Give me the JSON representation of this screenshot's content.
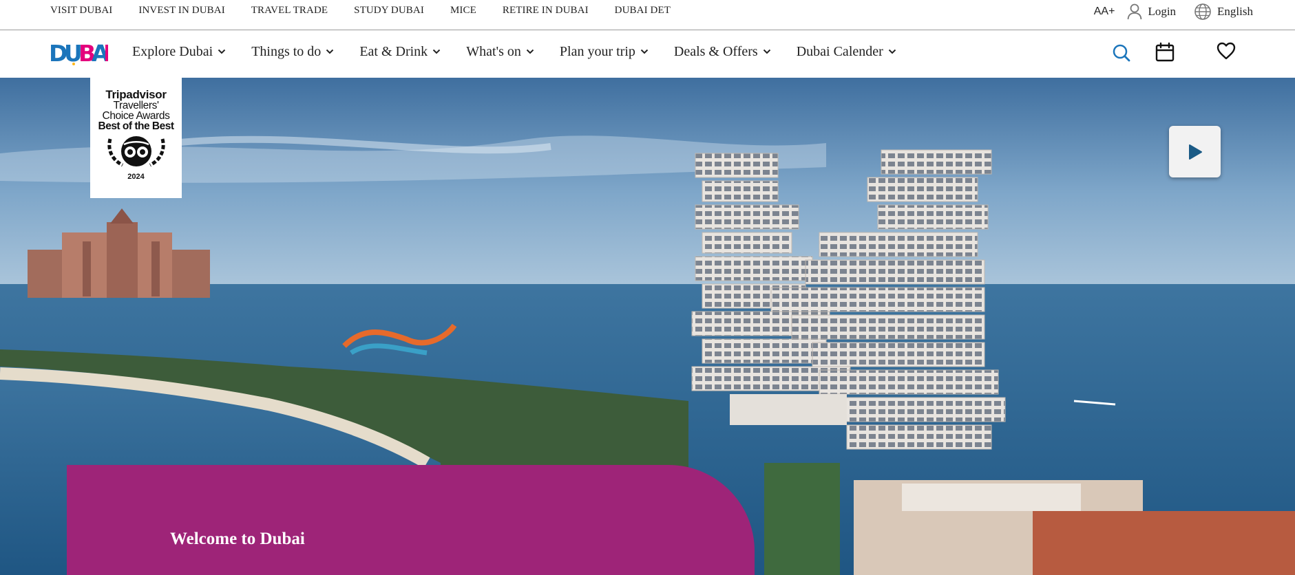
{
  "topbar": {
    "links": [
      "VISIT DUBAI",
      "INVEST IN DUBAI",
      "TRAVEL TRADE",
      "STUDY DUBAI",
      "MICE",
      "RETIRE IN DUBAI",
      "DUBAI DET"
    ],
    "font_size_label": "AA+",
    "login_label": "Login",
    "language_label": "English"
  },
  "logo": {
    "text": "DUBAI",
    "colors": [
      "#1b75bb",
      "#e4007c",
      "#ffb81c"
    ]
  },
  "nav": {
    "items": [
      "Explore Dubai",
      "Things to do",
      "Eat & Drink",
      "What's on",
      "Plan your trip",
      "Deals & Offers",
      "Dubai Calender"
    ],
    "icons": [
      "search-icon",
      "calendar-icon",
      "heart-icon"
    ]
  },
  "badge": {
    "line1": "Tripadvisor",
    "line2": "Travellers'",
    "line3": "Choice Awards",
    "line4": "Best of the Best",
    "year": "2024"
  },
  "hero": {
    "welcome_text": "Welcome to Dubai",
    "play_icon": "play-icon",
    "accent_color": "#9e2478"
  }
}
